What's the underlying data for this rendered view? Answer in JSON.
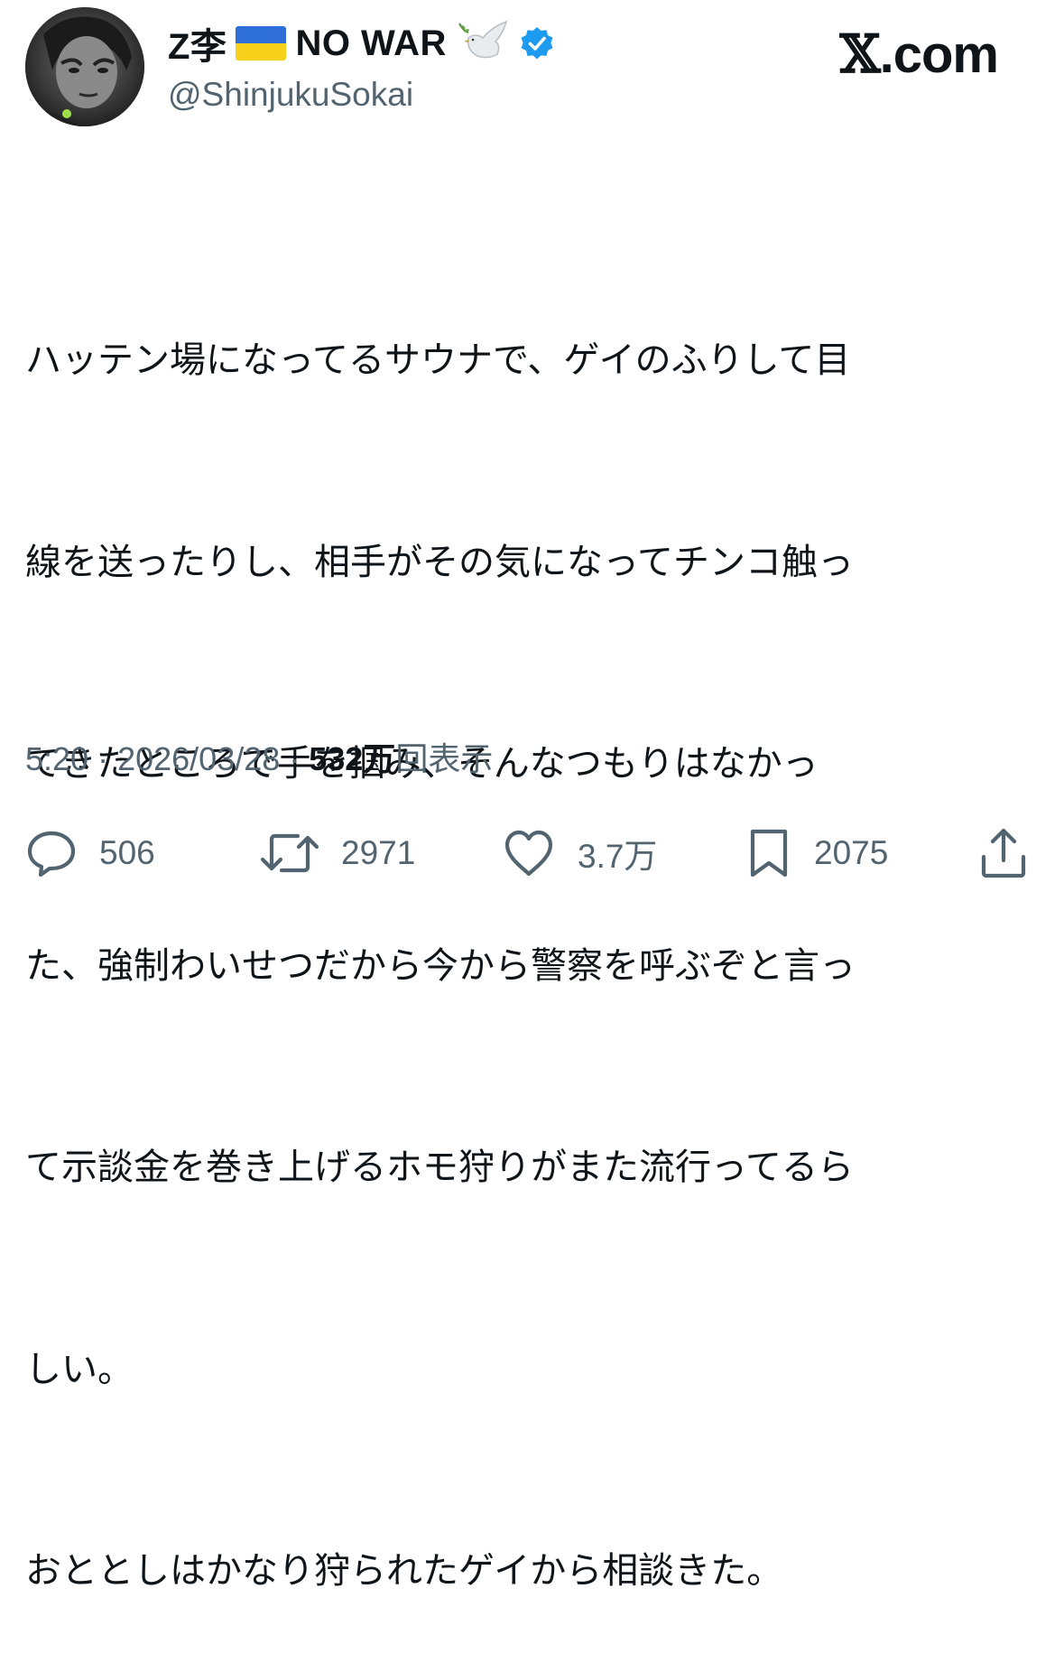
{
  "author": {
    "display_name": "Z李",
    "flag_icon": "ukraine-flag-icon",
    "name_suffix": "NO WAR",
    "dove_icon": "dove-with-olive-branch-icon",
    "verified_icon": "verified-badge-icon",
    "verified_color": "#1d9bf0",
    "handle": "@ShinjukuSokai"
  },
  "site": {
    "logo_mark": "𝕏",
    "logo_text": ".com"
  },
  "tweet": {
    "lines": [
      "ハッテン場になってるサウナで、ゲイのふりして目",
      "線を送ったりし、相手がその気になってチンコ触っ",
      "てきたところで手を掴み、そんなつもりはなかっ",
      "た、強制わいせつだから今から警察を呼ぶぞと言っ",
      "て示談金を巻き上げるホモ狩りがまた流行ってるら",
      "しい。",
      "おととしはかなり狩られたゲイから相談きた。"
    ]
  },
  "meta": {
    "time": "5:20",
    "separator": " · ",
    "date": "2026/03/28",
    "views_count": "532万",
    "views_label": "回表示"
  },
  "actions": {
    "replies": "506",
    "reposts": "2971",
    "likes": "3.7万",
    "bookmarks": "2075"
  },
  "colors": {
    "text_primary": "#0f1419",
    "text_secondary": "#536471",
    "flag_blue": "#2d6fd6",
    "flag_yellow": "#f7d21c"
  }
}
